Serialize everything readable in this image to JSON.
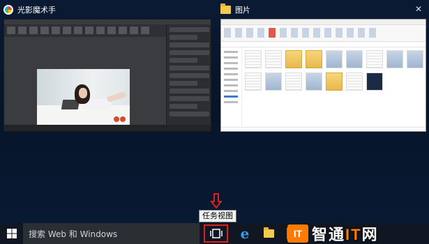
{
  "task_view": {
    "windows": [
      {
        "title": "光影魔术手",
        "icon": "app-logo-icon"
      },
      {
        "title": "图片",
        "icon": "folder-icon"
      }
    ]
  },
  "tooltip": {
    "text": "任务视图"
  },
  "taskbar": {
    "search_placeholder": "搜索 Web 和 Windows",
    "task_view_label": "任务视图"
  },
  "watermark": {
    "logo_text": "IT",
    "text_prefix": "智通",
    "text_it": "IT",
    "text_suffix": "网"
  },
  "colors": {
    "highlight_red": "#e0201b",
    "taskbar": "#101722",
    "search_box": "#2b2e33",
    "edge_blue": "#3f9ae6",
    "brand_orange": "#ff7a00"
  }
}
